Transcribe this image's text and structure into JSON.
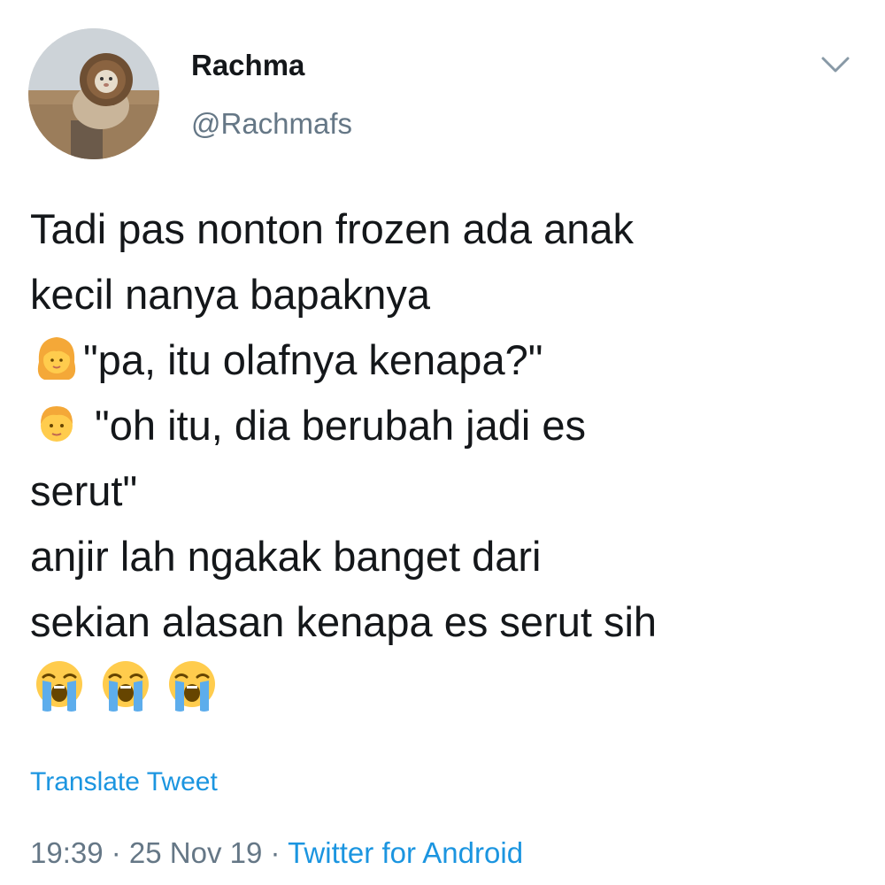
{
  "author": {
    "display_name": "Rachma",
    "handle": "@Rachmafs",
    "avatar_icon": "lion-mane-cat-avatar"
  },
  "menu": {
    "icon": "chevron-down-icon"
  },
  "tweet": {
    "lines": [
      {
        "text": "Tadi pas nonton frozen ada anak"
      },
      {
        "text": "kecil nanya bapaknya"
      },
      {
        "emoji": "girl-emoji",
        "text": "\"pa, itu olafnya kenapa?\""
      },
      {
        "emoji": "boy-emoji",
        "text": " \"oh itu, dia berubah jadi es"
      },
      {
        "text": "serut\""
      },
      {
        "text": "anjir lah ngakak banget dari"
      },
      {
        "text": "sekian alasan kenapa es serut sih"
      }
    ],
    "trailing_emojis": [
      "loudly-crying-face-emoji",
      "loudly-crying-face-emoji",
      "loudly-crying-face-emoji"
    ]
  },
  "translate_label": "Translate Tweet",
  "meta": {
    "time": "19:39",
    "separator_1": " · ",
    "date": "25 Nov 19",
    "separator_2": " · ",
    "source": "Twitter for Android"
  },
  "colors": {
    "text": "#14171a",
    "secondary": "#657786",
    "link": "#1b95e0"
  }
}
